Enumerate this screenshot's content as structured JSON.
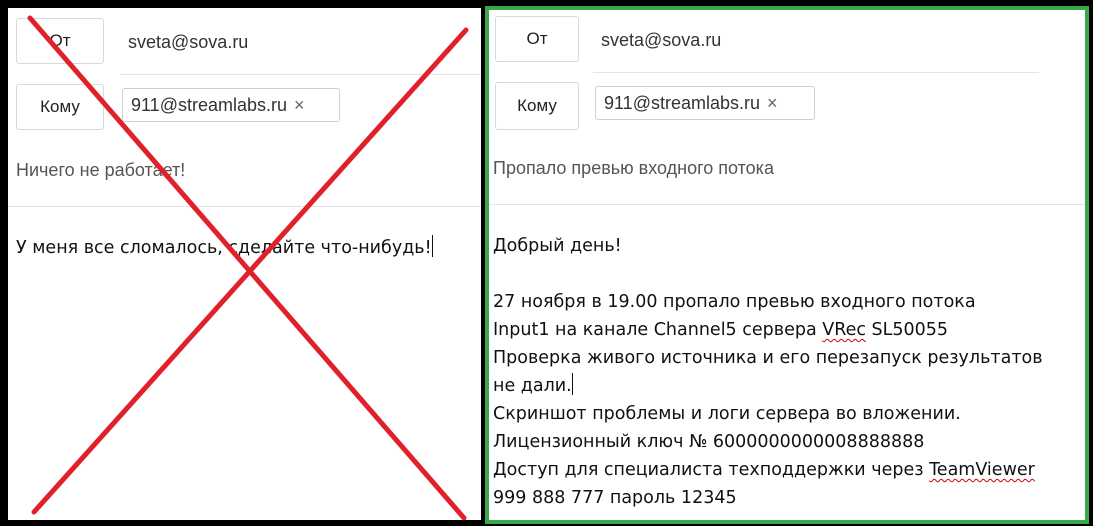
{
  "left": {
    "from_label": "От",
    "from_value": "sveta@sova.ru",
    "to_label": "Кому",
    "to_chip": "911@streamlabs.ru",
    "chip_close": "×",
    "subject": "Ничего не работает!",
    "body": "У меня все сломалось, сделайте что-нибудь!"
  },
  "right": {
    "from_label": "От",
    "from_value": "sveta@sova.ru",
    "to_label": "Кому",
    "to_chip": "911@streamlabs.ru",
    "chip_close": "×",
    "subject": "Пропало превью входного потока",
    "body": {
      "greeting": "Добрый день!",
      "line1": "27 ноября в 19.00 пропало превью входного потока",
      "line2_a": "Input1 на канале Channel5 сервера ",
      "line2_b": "VRec",
      "line2_c": " SL50055",
      "line3": "Проверка живого источника и его перезапуск результатов",
      "line4": "не дали.",
      "line5": "Скриншот проблемы и логи сервера во вложении.",
      "line6": "Лицензионный ключ № 6000000000008888888",
      "line7_a": "Доступ для специалиста техподдержки через ",
      "line7_b": "TeamViewer",
      "line8": "999 888 777 пароль 12345"
    }
  },
  "colors": {
    "cross": "#e0202a",
    "good_border": "#3aa84a",
    "spellcheck": "#d40000"
  }
}
